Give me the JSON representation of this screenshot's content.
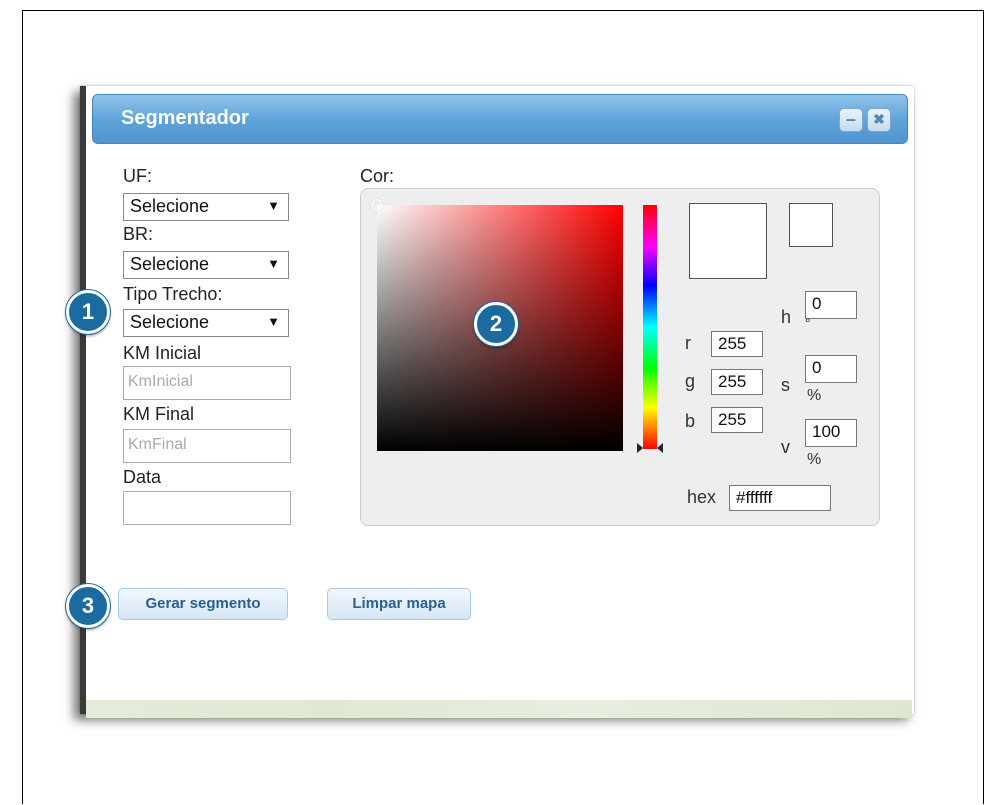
{
  "window": {
    "title": "Segmentador",
    "minimize_label": "–",
    "close_label": "✖"
  },
  "form": {
    "uf_label": "UF:",
    "uf_value": "Selecione",
    "br_label": "BR:",
    "br_value": "Selecione",
    "tipo_label": "Tipo Trecho:",
    "tipo_value": "Selecione",
    "km_inicial_label": "KM Inicial",
    "km_inicial_placeholder": "KmInicial",
    "km_final_label": "KM Final",
    "km_final_placeholder": "KmFinal",
    "data_label": "Data",
    "data_value": ""
  },
  "color": {
    "label": "Cor:",
    "r_label": "r",
    "r": "255",
    "g_label": "g",
    "g": "255",
    "b_label": "b",
    "b": "255",
    "h_label": "h",
    "h": "0",
    "h_unit": "°",
    "s_label": "s",
    "s": "0",
    "s_unit": "%",
    "v_label": "v",
    "v": "100",
    "v_unit": "%",
    "hex_label": "hex",
    "hex": "#ffffff"
  },
  "buttons": {
    "gerar": "Gerar segmento",
    "limpar": "Limpar mapa"
  },
  "badges": {
    "one": "1",
    "two": "2",
    "three": "3"
  },
  "icons": {
    "arrow": "▼"
  }
}
